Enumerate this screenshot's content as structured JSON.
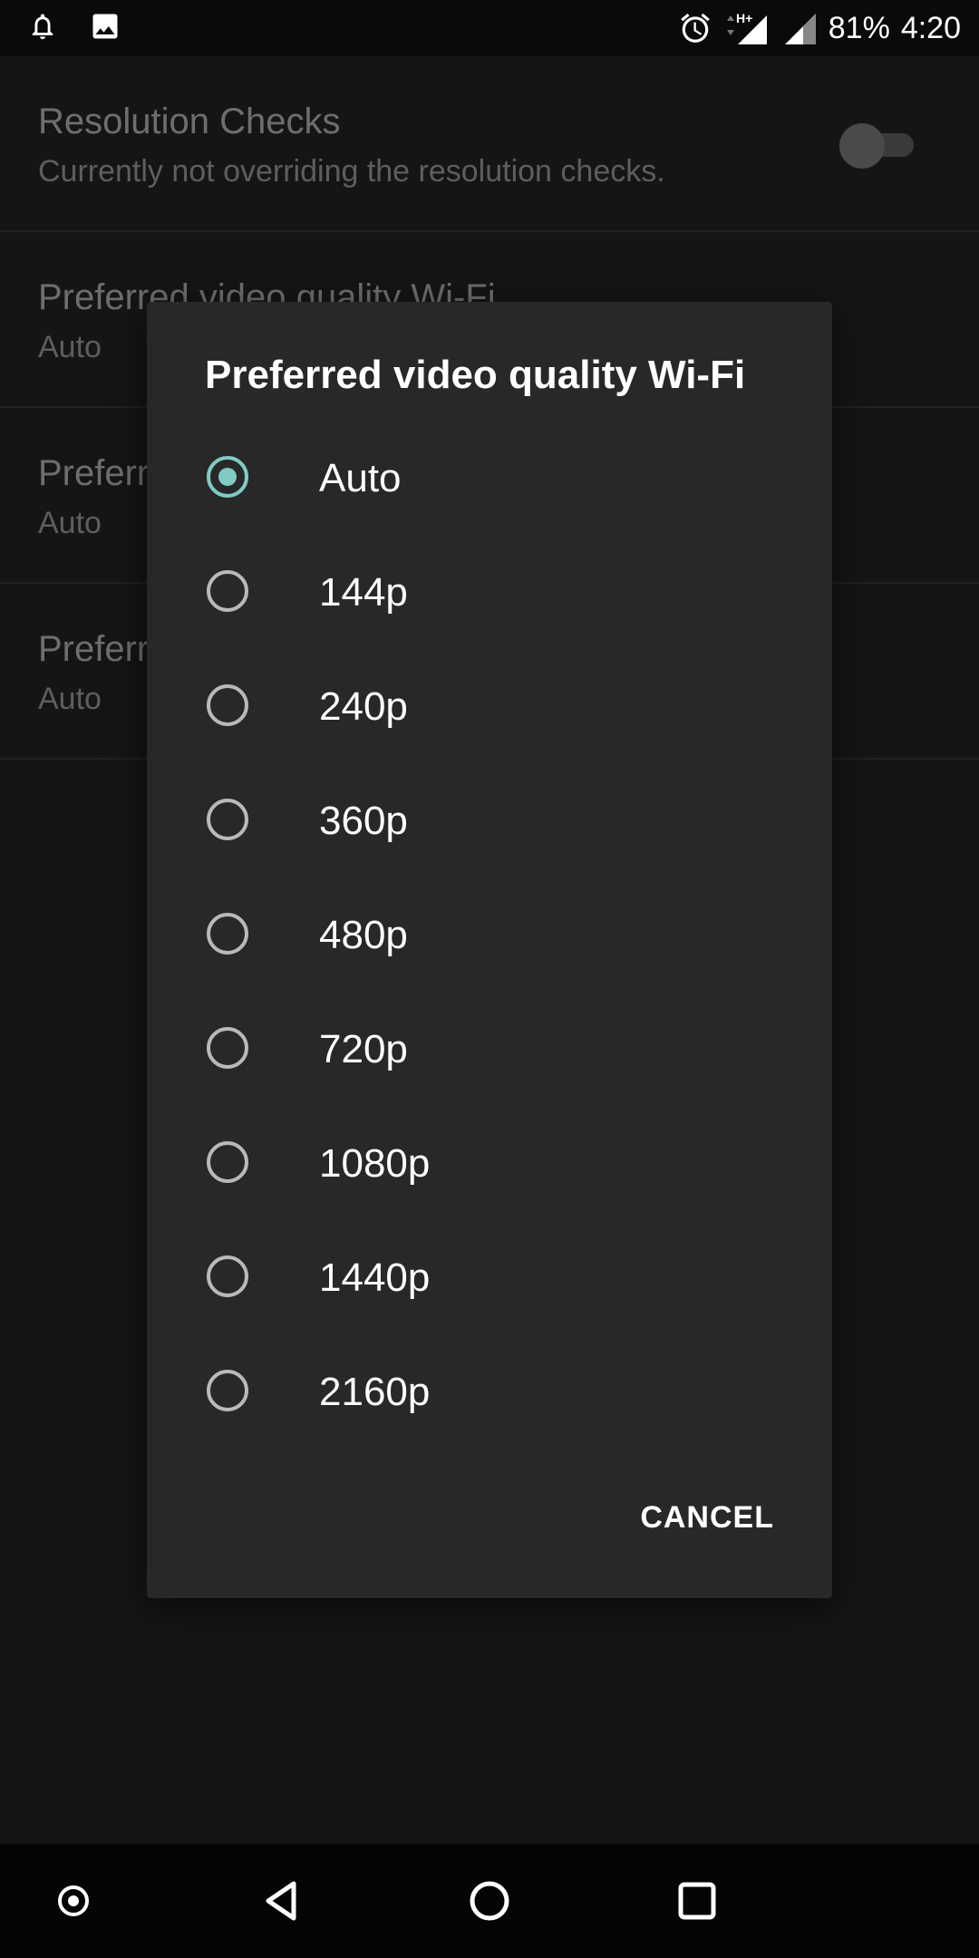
{
  "status_bar": {
    "battery": "81%",
    "time": "4:20",
    "network": "H+",
    "icons_left": [
      "notification-bell-icon",
      "image-icon"
    ],
    "icons_right": [
      "alarm-icon",
      "signal-icon",
      "signal-icon"
    ]
  },
  "settings": {
    "items": [
      {
        "title": "Resolution Checks",
        "summary": "Currently not overriding the resolution checks.",
        "toggle": false
      },
      {
        "title": "Preferred video quality Wi-Fi",
        "summary": "Auto"
      },
      {
        "title": "Preferred video quality Mobile",
        "summary": "Auto"
      },
      {
        "title": "Preferred video quality Metered",
        "summary": "Auto"
      }
    ]
  },
  "dialog": {
    "title": "Preferred video quality Wi-Fi",
    "options": [
      "Auto",
      "144p",
      "240p",
      "360p",
      "480p",
      "720p",
      "1080p",
      "1440p",
      "2160p"
    ],
    "selected": "Auto",
    "cancel_label": "CANCEL"
  },
  "nav_bar": {
    "buttons": [
      "assistant-icon",
      "back-icon",
      "home-icon",
      "recents-icon"
    ]
  },
  "colors": {
    "accent": "#80cbc4",
    "dialog_bg": "#282828",
    "background": "#151515"
  }
}
